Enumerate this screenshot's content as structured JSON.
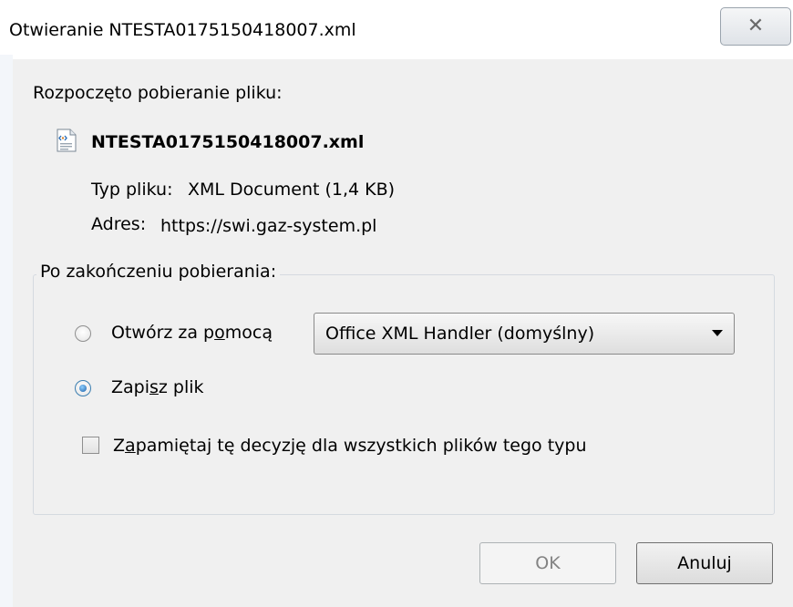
{
  "window": {
    "title": "Otwieranie NTESTA0175150418007.xml",
    "close_glyph": "✕"
  },
  "download": {
    "started_label": "Rozpoczęto pobieranie pliku:",
    "filename": "NTESTA0175150418007.xml",
    "file_icon": "xml-file-icon",
    "type_label": "Typ pliku:",
    "type_value": "XML Document (1,4 KB)",
    "address_label": "Adres:",
    "address_value": "https://swi.gaz-system.pl"
  },
  "after_download": {
    "group_label": "Po zakończeniu pobierania:",
    "open_with": {
      "label_before": "Otwórz za p",
      "label_accel": "o",
      "label_after": "mocą",
      "selected": false
    },
    "handler_select": {
      "value": "Office XML Handler (domyślny)"
    },
    "save_file": {
      "label_before": "Zapi",
      "label_accel": "s",
      "label_after": "z plik",
      "selected": true
    },
    "remember": {
      "label_before": "Z",
      "label_accel": "a",
      "label_after": "pamiętaj tę decyzję dla wszystkich plików tego typu",
      "checked": false
    }
  },
  "buttons": {
    "ok_label": "OK",
    "cancel_label": "Anuluj"
  },
  "colors": {
    "window_bg": "#f0f0f0",
    "radio_accent": "#1c5fa8"
  }
}
